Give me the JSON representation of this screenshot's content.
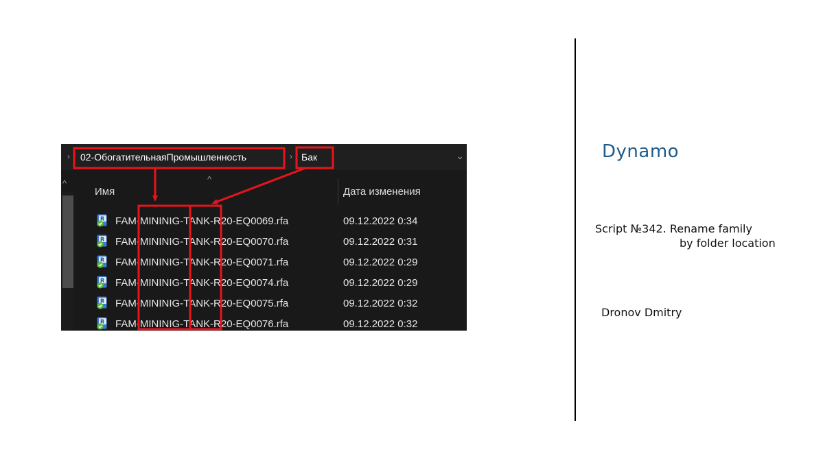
{
  "explorer": {
    "breadcrumb": [
      {
        "label": "02-ОбогатительнаяПромышленность"
      },
      {
        "label": "Бак"
      }
    ],
    "columns": {
      "name": "Имя",
      "date": "Дата изменения"
    },
    "files": [
      {
        "name": "FAM-MININIG-TANK-R20-EQ0069.rfa",
        "date": "09.12.2022 0:34"
      },
      {
        "name": "FAM-MININIG-TANK-R20-EQ0070.rfa",
        "date": "09.12.2022 0:31"
      },
      {
        "name": "FAM-MININIG-TANK-R20-EQ0071.rfa",
        "date": "09.12.2022 0:29"
      },
      {
        "name": "FAM-MININIG-TANK-R20-EQ0074.rfa",
        "date": "09.12.2022 0:29"
      },
      {
        "name": "FAM-MININIG-TANK-R20-EQ0075.rfa",
        "date": "09.12.2022 0:32"
      },
      {
        "name": "FAM-MININIG-TANK-R20-EQ0076.rfa",
        "date": "09.12.2022 0:32"
      }
    ],
    "file_icon": "revit-family-icon",
    "highlight_color": "#e8141c"
  },
  "info": {
    "title": "Dynamo",
    "script_line1": "Script №342. Rename family",
    "script_line2": "by folder location",
    "author": "Dronov Dmitry",
    "title_color": "#1f5c8b"
  }
}
